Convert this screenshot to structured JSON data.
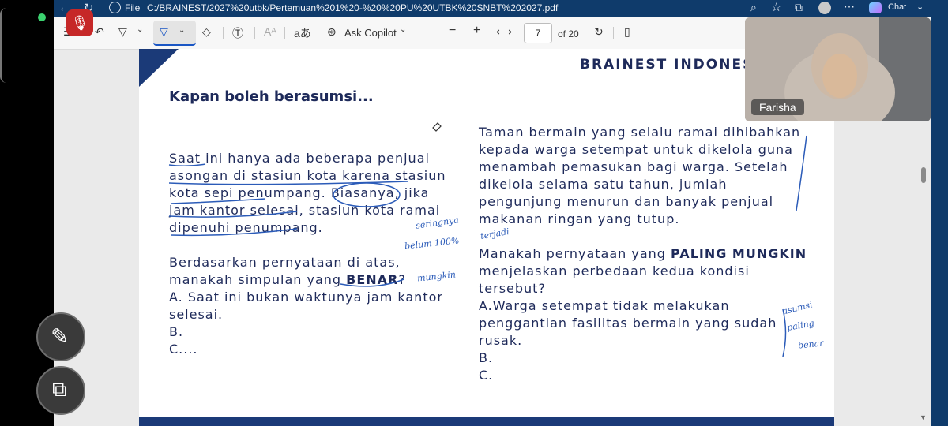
{
  "browser": {
    "file_label": "File",
    "url": "C:/BRAINEST/2027%20utbk/Pertemuan%201%20-%20%20PU%20UTBK%20SNBT%202027.pdf",
    "chat_label": "Chat"
  },
  "toolbar": {
    "ask_copilot": "Ask Copilot",
    "page_current": "7",
    "page_total": "of 20"
  },
  "document": {
    "brand": "BRAINEST INDONESIA",
    "heading": "Kapan boleh berasumsi...",
    "left_lines": [
      "Saat ini hanya ada beberapa penjual",
      "asongan di stasiun kota karena stasiun",
      "kota sepi penumpang. Biasanya, jika",
      "jam kantor selesai, stasiun kota ramai",
      "dipenuhi penumpang.",
      "",
      "Berdasarkan pernyataan di atas,"
    ],
    "left_q_prefix": "manakah simpulan yang ",
    "left_q_bold": "BENAR",
    "left_q_suffix": "?",
    "left_options": [
      "A. Saat ini bukan waktunya jam kantor",
      "selesai.",
      "B.",
      "C...."
    ],
    "right_lines": [
      "Taman bermain yang selalu ramai dihibahkan",
      "kepada warga setempat untuk dikelola guna",
      "menambah pemasukan bagi warga. Setelah",
      "dikelola selama satu tahun, jumlah",
      "pengunjung menurun dan banyak penjual",
      "makanan ringan yang tutup."
    ],
    "right_q_prefix": "Manakah pernyataan yang ",
    "right_q_bold": "PALING MUNGKIN",
    "right_q_lines": [
      "menjelaskan perbedaan kedua kondisi",
      "tersebut?"
    ],
    "right_options": [
      "A.Warga setempat tidak melakukan",
      "penggantian fasilitas bermain yang sudah",
      "rusak.",
      "B.",
      "C."
    ]
  },
  "annotations": {
    "a1": "seringnya",
    "a2": "belum 100%",
    "a3": "terjadi",
    "a4": "mungkin",
    "a5": "asumsi",
    "a6": "paling",
    "a7": "benar"
  },
  "video": {
    "participant": "Farisha"
  },
  "colors": {
    "accent": "#0f3b6b",
    "ink": "#2b5bb8",
    "doc_text": "#1e2a5a",
    "page_footer": "#1b3a78"
  }
}
